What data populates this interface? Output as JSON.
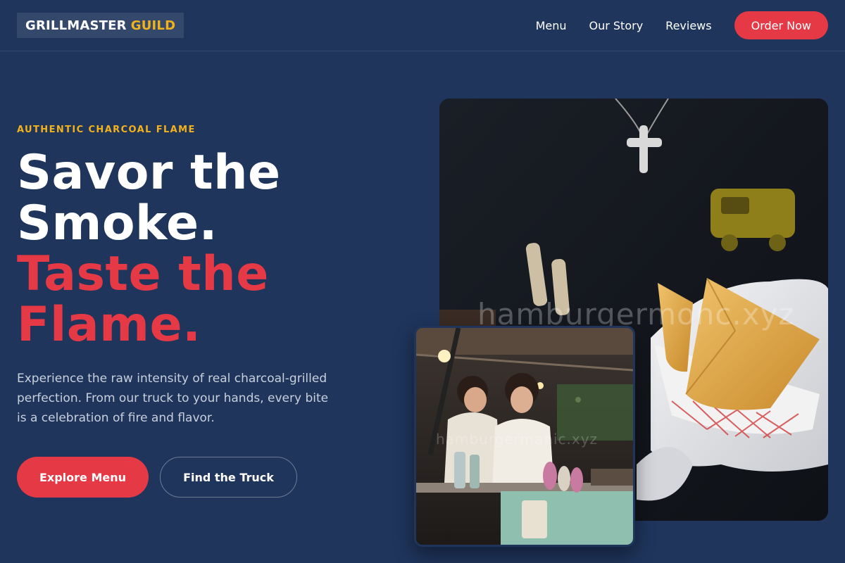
{
  "nav": {
    "logo_part1": "GRILLMASTER",
    "logo_part2": "GUILD",
    "links": [
      "Menu",
      "Our Story",
      "Reviews"
    ],
    "cta": "Order Now"
  },
  "hero": {
    "eyebrow": "AUTHENTIC CHARCOAL FLAME",
    "headline_line1": "Savor the",
    "headline_line2": "Smoke.",
    "headline_line3": "Taste the",
    "headline_line4": "Flame.",
    "description": "Experience the raw intensity of real charcoal-grilled perfection. From our truck to your hands, every bite is a celebration of fire and flavor.",
    "primary_button": "Explore Menu",
    "secondary_button": "Find the Truck"
  },
  "images": {
    "main_watermark": "hamburgermonc.xyz",
    "secondary_watermark": "hamburgermanic.xyz"
  },
  "colors": {
    "background": "#1f355c",
    "accent_red": "#e63946",
    "accent_gold": "#f2b21c"
  }
}
